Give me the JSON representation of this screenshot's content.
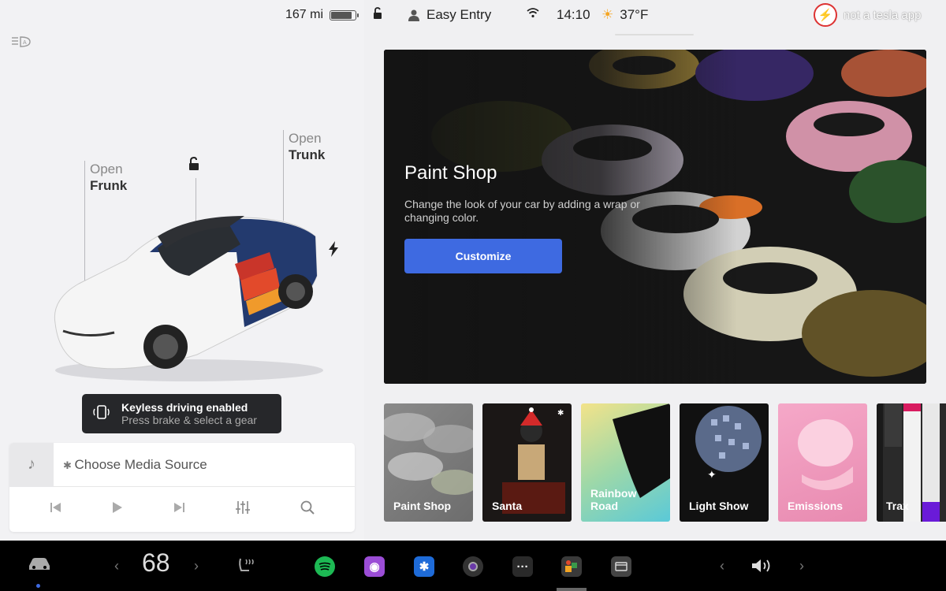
{
  "status": {
    "range": "167 mi",
    "battery_level": 0.85,
    "profile": "Easy Entry",
    "time": "14:10",
    "temperature": "37°F",
    "brand": "not a tesla app"
  },
  "car": {
    "frunk_l1": "Open",
    "frunk_l2": "Frunk",
    "trunk_l1": "Open",
    "trunk_l2": "Trunk"
  },
  "toast": {
    "title": "Keyless driving enabled",
    "subtitle": "Press brake & select a gear"
  },
  "media": {
    "source": "Choose Media Source"
  },
  "hero": {
    "title": "Paint Shop",
    "description": "Change the look of your car by adding a wrap or changing color.",
    "button": "Customize"
  },
  "tiles": [
    {
      "label": "Paint Shop"
    },
    {
      "label": "Santa"
    },
    {
      "label": "Rainbow Road"
    },
    {
      "label": "Light Show"
    },
    {
      "label": "Emissions"
    },
    {
      "label": "Trax"
    }
  ],
  "dock": {
    "temperature": "68"
  },
  "colors": {
    "accent": "#3e6ae1",
    "dock_bg": "#000000",
    "toast_bg": "#26272a"
  }
}
